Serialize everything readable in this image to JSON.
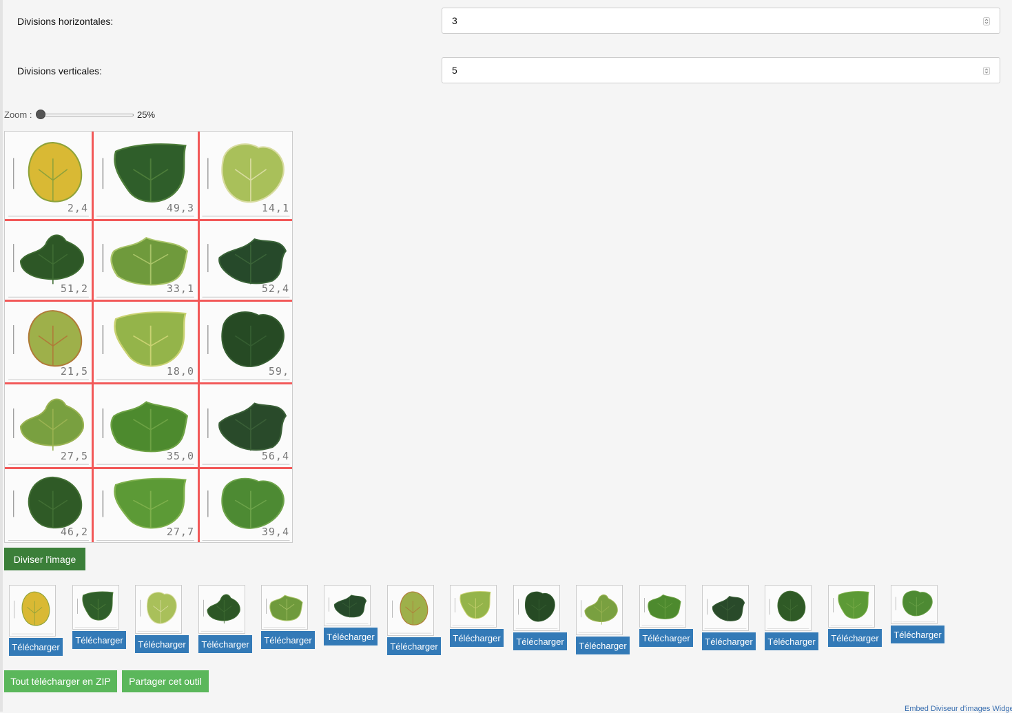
{
  "form": {
    "horizontal_label": "Divisions horizontales:",
    "horizontal_value": "3",
    "vertical_label": "Divisions verticales:",
    "vertical_value": "5"
  },
  "zoom": {
    "label": "Zoom :",
    "value_text": "25%",
    "value": 25
  },
  "preview": {
    "cells": [
      {
        "label": "2,4",
        "leaf": "#d9b934",
        "leaf2": "#8ea23a"
      },
      {
        "label": "49,3",
        "leaf": "#2f5e2a",
        "leaf2": "#4d7d3a"
      },
      {
        "label": "14,1",
        "leaf": "#a9c05a",
        "leaf2": "#d8dca0"
      },
      {
        "label": "51,2",
        "leaf": "#2d5726",
        "leaf2": "#3f6c33"
      },
      {
        "label": "33,1",
        "leaf": "#6f9a3c",
        "leaf2": "#a9c468"
      },
      {
        "label": "52,4",
        "leaf": "#26492a",
        "leaf2": "#3a6338"
      },
      {
        "label": "21,5",
        "leaf": "#9eb04a",
        "leaf2": "#b07a38"
      },
      {
        "label": "18,0",
        "leaf": "#94b44a",
        "leaf2": "#c9d272"
      },
      {
        "label": "59,",
        "leaf": "#264a24",
        "leaf2": "#355d31"
      },
      {
        "label": "27,5",
        "leaf": "#79a040",
        "leaf2": "#9ab352"
      },
      {
        "label": "35,0",
        "leaf": "#4d8a2e",
        "leaf2": "#6da244"
      },
      {
        "label": "56,4",
        "leaf": "#294a2a",
        "leaf2": "#3a5f37"
      },
      {
        "label": "46,2",
        "leaf": "#2f5a26",
        "leaf2": "#426f34"
      },
      {
        "label": "27,7",
        "leaf": "#5c9a36",
        "leaf2": "#7eb04c"
      },
      {
        "label": "39,4",
        "leaf": "#4d8a33",
        "leaf2": "#6da34a"
      }
    ]
  },
  "actions": {
    "split_label": "Diviser l'image",
    "zip_label": "Tout télécharger en ZIP",
    "share_label": "Partager cet outil"
  },
  "downloads": {
    "button_label": "Télécharger",
    "count": 15
  },
  "footer": {
    "embed_text": "Embed Diviseur d'images Widget"
  },
  "colors": {
    "grid_line": "#f25858",
    "download_blue": "#337ab7",
    "green_dark": "#3b7f39",
    "green_light": "#5bb75b"
  }
}
